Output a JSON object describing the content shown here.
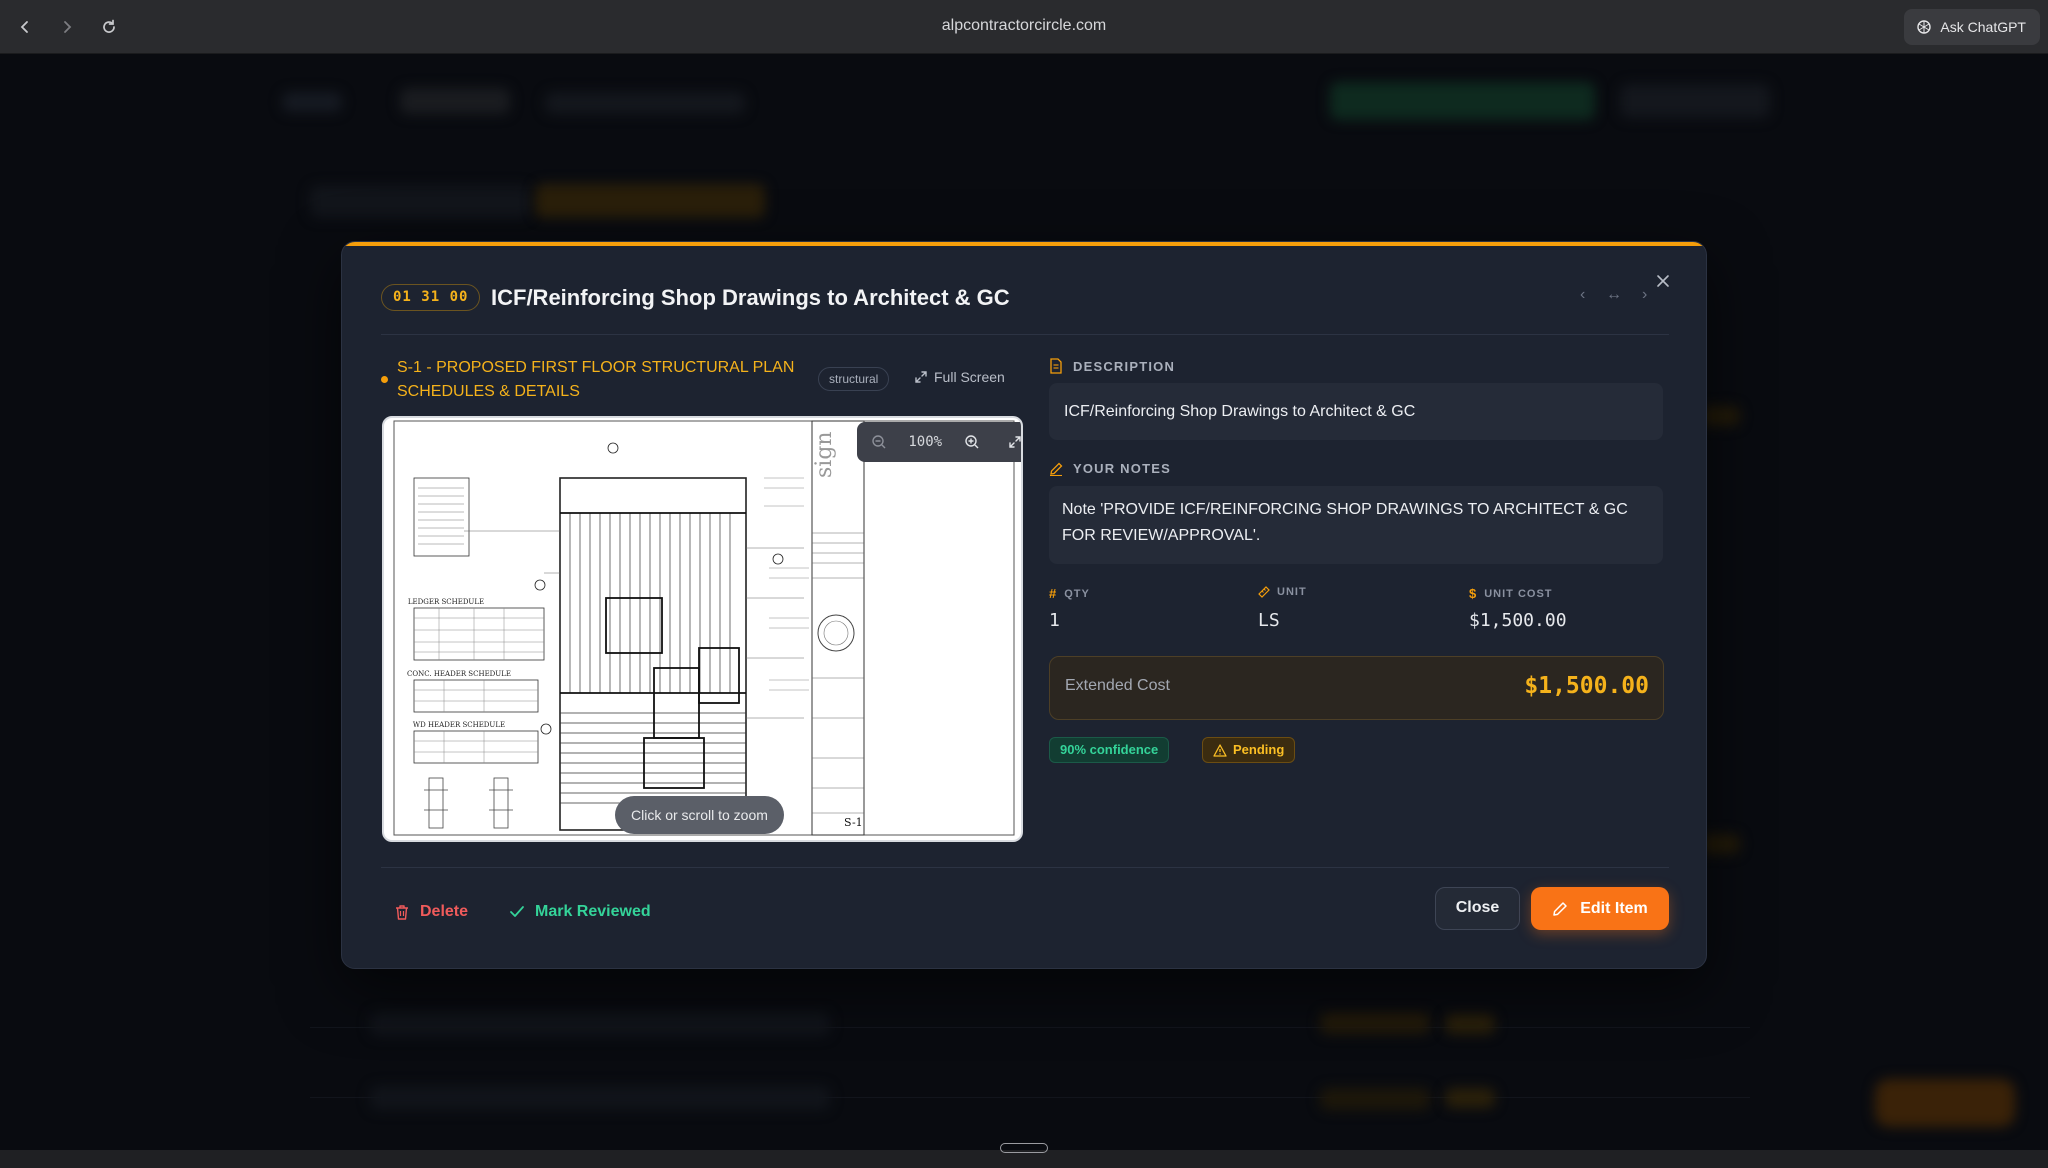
{
  "browser": {
    "url": "alpcontractorcircle.com",
    "ask_label": "Ask ChatGPT"
  },
  "modal": {
    "code": "01 31 00",
    "title": "ICF/Reinforcing Shop Drawings to Architect & GC",
    "nav": {
      "prev": "‹",
      "swap": "↔",
      "next": "›"
    },
    "close_icon": "close-icon",
    "drawing": {
      "sheet_title": "S-1 - PROPOSED FIRST FLOOR STRUCTURAL PLAN SCHEDULES & DETAILS",
      "tag": "structural",
      "fullscreen_label": "Full Screen",
      "zoom_level": "100%",
      "zoom_hint": "Click or scroll to zoom",
      "sheet_number": "S-1"
    },
    "description": {
      "label": "DESCRIPTION",
      "value": "ICF/Reinforcing Shop Drawings to Architect & GC"
    },
    "notes": {
      "label": "YOUR NOTES",
      "value": "Note 'PROVIDE ICF/REINFORCING SHOP DRAWINGS TO ARCHITECT & GC FOR REVIEW/APPROVAL'."
    },
    "qty": {
      "label": "QTY",
      "value": "1"
    },
    "unit": {
      "label": "UNIT",
      "value": "LS"
    },
    "unit_cost": {
      "label": "UNIT COST",
      "value": "$1,500.00"
    },
    "extended_cost": {
      "label": "Extended Cost",
      "value": "$1,500.00"
    },
    "confidence_badge": "90% confidence",
    "status_badge": "Pending",
    "actions": {
      "delete": "Delete",
      "mark_reviewed": "Mark Reviewed",
      "close": "Close",
      "edit": "Edit Item"
    },
    "colors": {
      "accent": "#f59e0b",
      "primary_button": "#f97316",
      "danger": "#f05b5b",
      "success": "#34d399"
    }
  }
}
